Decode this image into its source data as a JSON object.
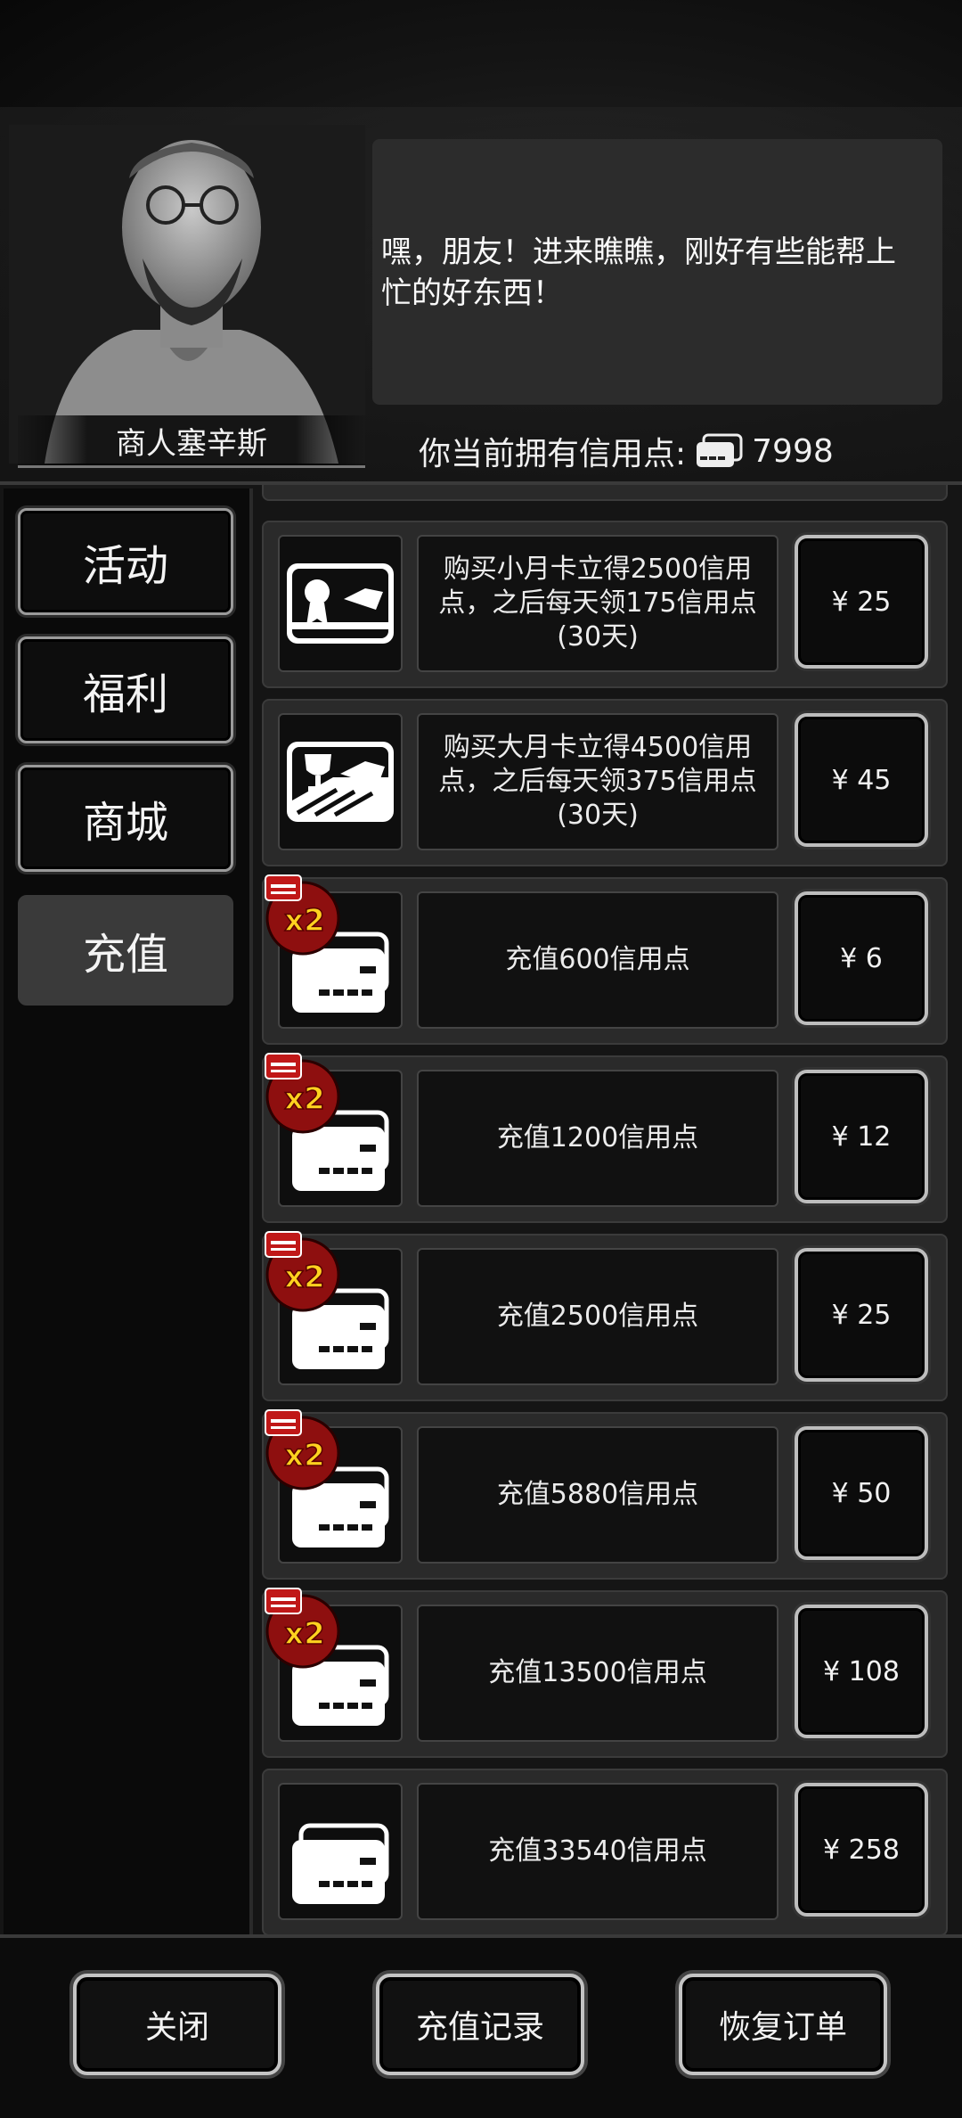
{
  "merchant": {
    "name": "商人塞辛斯",
    "dialog": "嘿，朋友！进来瞧瞧，刚好有些能帮上忙的好东西！"
  },
  "credits": {
    "label": "你当前拥有信用点:",
    "value": "7998",
    "icon": "credit-card-icon"
  },
  "sidebar": {
    "items": [
      {
        "label": "活动",
        "active": false
      },
      {
        "label": "福利",
        "active": false
      },
      {
        "label": "商城",
        "active": false
      },
      {
        "label": "充值",
        "active": true
      }
    ]
  },
  "shop": {
    "items": [
      {
        "icon": "small-monthly-card-icon",
        "desc": "购买小月卡立得2500信用点，之后每天领175信用点(30天)",
        "price": "¥ 25",
        "double": false
      },
      {
        "icon": "big-monthly-card-icon",
        "desc": "购买大月卡立得4500信用点，之后每天领375信用点(30天)",
        "price": "¥ 45",
        "double": false
      },
      {
        "icon": "credit-cards-icon",
        "desc": "充值600信用点",
        "price": "¥ 6",
        "double": true,
        "badge": "x2"
      },
      {
        "icon": "credit-cards-icon",
        "desc": "充值1200信用点",
        "price": "¥ 12",
        "double": true,
        "badge": "x2"
      },
      {
        "icon": "credit-cards-icon",
        "desc": "充值2500信用点",
        "price": "¥ 25",
        "double": true,
        "badge": "x2"
      },
      {
        "icon": "credit-cards-icon",
        "desc": "充值5880信用点",
        "price": "¥ 50",
        "double": true,
        "badge": "x2"
      },
      {
        "icon": "credit-cards-icon",
        "desc": "充值13500信用点",
        "price": "¥ 108",
        "double": true,
        "badge": "x2"
      },
      {
        "icon": "credit-cards-icon",
        "desc": "充值33540信用点",
        "price": "¥ 258",
        "double": false
      }
    ]
  },
  "footer": {
    "close": "关闭",
    "history": "充值记录",
    "restore": "恢复订单"
  },
  "colors": {
    "background": "#0b0b0b",
    "panel": "#2a2a2a",
    "badge_red": "#b01818",
    "badge_text": "#ffd21f"
  }
}
